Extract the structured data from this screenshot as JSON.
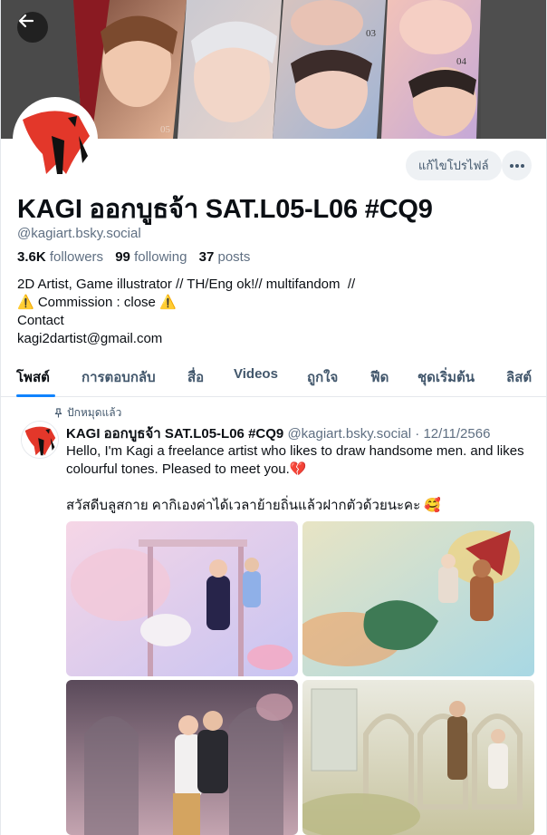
{
  "header": {
    "back_icon": "arrow-left-icon",
    "edit_profile_label": "แก้ไขโปรไฟล์",
    "more_icon": "ellipsis-icon"
  },
  "profile": {
    "display_name": "KAGI ออกบูธจ้า SAT.L05-L06 #CQ9",
    "handle": "@kagiart.bsky.social",
    "followers_count": "3.6K",
    "followers_label": "followers",
    "following_count": "99",
    "following_label": "following",
    "posts_count": "37",
    "posts_label": "posts",
    "bio": "2D Artist, Game illustrator // TH/Eng ok!// multifandom  //\n⚠️ Commission : close ⚠️\nContact\nkagi2dartist@gmail.com"
  },
  "tabs": [
    {
      "label": "โพสต์",
      "active": true
    },
    {
      "label": "การตอบกลับ",
      "active": false
    },
    {
      "label": "สื่อ",
      "active": false
    },
    {
      "label": "Videos",
      "active": false
    },
    {
      "label": "ถูกใจ",
      "active": false
    },
    {
      "label": "ฟีด",
      "active": false
    },
    {
      "label": "ชุดเริ่มต้น",
      "active": false
    },
    {
      "label": "ลิสต์",
      "active": false
    }
  ],
  "post": {
    "pinned_label": "ปักหมุดแล้ว",
    "author_name": "KAGI ออกบูธจ้า SAT.L05-L06 #CQ9",
    "author_handle": "@kagiart.bsky.social",
    "separator": " · ",
    "date": "12/11/2566",
    "text_line1": "Hello, I'm Kagi a freelance artist who likes to draw handsome men. and likes colourful tones. Pleased to meet you.💔",
    "text_line2": "สวัสดีบลูสกาย คากิเองค่าได้เวลาย้ายถิ่นแล้วฝากตัวด้วยนะคะ 🥰"
  },
  "banner": {
    "labels": [
      "03",
      "04",
      "05"
    ]
  },
  "colors": {
    "accent": "#1083fe",
    "text_primary": "#0b0f14",
    "text_secondary": "#5f6f82",
    "button_bg": "#eef1f4",
    "avatar_red": "#e3372a"
  }
}
